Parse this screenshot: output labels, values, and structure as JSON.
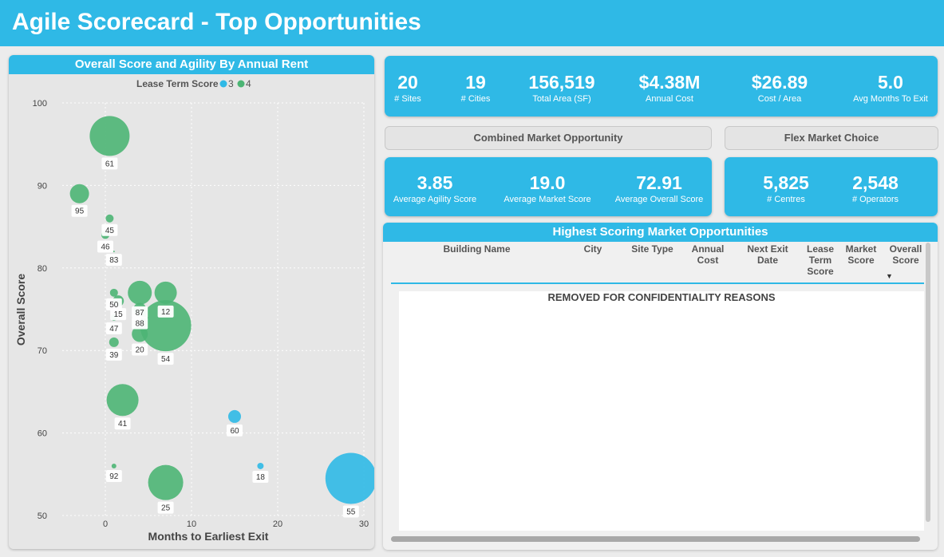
{
  "header": {
    "title": "Agile Scorecard - Top Opportunities"
  },
  "left_panel": {
    "title": "Overall Score and Agility By Annual Rent"
  },
  "kpis_top": [
    {
      "value": "20",
      "label": "# Sites"
    },
    {
      "value": "19",
      "label": "# Cities"
    },
    {
      "value": "156,519",
      "label": "Total Area (SF)"
    },
    {
      "value": "$4.38M",
      "label": "Annual Cost"
    },
    {
      "value": "$26.89",
      "label": "Cost / Area"
    },
    {
      "value": "5.0",
      "label": "Avg Months To Exit"
    }
  ],
  "sections": {
    "combined": "Combined Market Opportunity",
    "flex": "Flex Market Choice"
  },
  "kpis_combined": [
    {
      "value": "3.85",
      "label": "Average Agility Score"
    },
    {
      "value": "19.0",
      "label": "Average Market Score"
    },
    {
      "value": "72.91",
      "label": "Average Overall Score"
    }
  ],
  "kpis_flex": [
    {
      "value": "5,825",
      "label": "# Centres"
    },
    {
      "value": "2,548",
      "label": "# Operators"
    }
  ],
  "table": {
    "title": "Highest Scoring Market Opportunities",
    "columns": [
      "Building Name",
      "City",
      "Site Type",
      "Annual Cost",
      "Next Exit Date",
      "Lease Term Score",
      "Market Score",
      "Overall Score"
    ],
    "sort_indicator": "▼",
    "removed_text": "REMOVED FOR CONFIDENTIALITY REASONS"
  },
  "chart_data": {
    "type": "scatter",
    "title": "Overall Score and Agility By Annual Rent",
    "xlabel": "Months to Earliest Exit",
    "ylabel": "Overall Score",
    "xlim": [
      -5,
      30
    ],
    "ylim": [
      50,
      100
    ],
    "xticks": [
      0,
      10,
      20,
      30
    ],
    "yticks": [
      50,
      60,
      70,
      80,
      90,
      100
    ],
    "grid": true,
    "legend": {
      "title": "Lease Term Score",
      "placement": "top",
      "entries": [
        {
          "name": "3",
          "color": "#2fb9e6"
        },
        {
          "name": "4",
          "color": "#4cb574"
        }
      ]
    },
    "series": [
      {
        "name": "3",
        "color": "#2fb9e6",
        "points": [
          {
            "x": 15,
            "y": 62,
            "size": 8,
            "label": "60"
          },
          {
            "x": 18,
            "y": 56,
            "size": 4,
            "label": "18"
          },
          {
            "x": 28.5,
            "y": 54.5,
            "size": 32,
            "label": "55"
          }
        ]
      },
      {
        "name": "4",
        "color": "#4cb574",
        "points": [
          {
            "x": 0.5,
            "y": 96,
            "size": 25,
            "label": "61"
          },
          {
            "x": -3,
            "y": 89,
            "size": 12,
            "label": "95"
          },
          {
            "x": 0.5,
            "y": 86,
            "size": 5,
            "label": "45"
          },
          {
            "x": 0,
            "y": 84,
            "size": 5,
            "label": "46"
          },
          {
            "x": 1,
            "y": 82,
            "size": 1,
            "label": "83"
          },
          {
            "x": 1,
            "y": 77,
            "size": 5,
            "label": "50"
          },
          {
            "x": 4,
            "y": 77,
            "size": 15,
            "label": "87"
          },
          {
            "x": 7,
            "y": 77,
            "size": 14,
            "label": "12"
          },
          {
            "x": 1.5,
            "y": 76,
            "size": 7,
            "label": "15"
          },
          {
            "x": 4,
            "y": 75,
            "size": 8,
            "label": "88"
          },
          {
            "x": 7,
            "y": 73,
            "size": 32,
            "label": "54"
          },
          {
            "x": 1,
            "y": 74,
            "size": 4,
            "label": "47"
          },
          {
            "x": 4,
            "y": 72,
            "size": 10,
            "label": "20"
          },
          {
            "x": 1,
            "y": 71,
            "size": 6,
            "label": "39"
          },
          {
            "x": 2,
            "y": 64,
            "size": 20,
            "label": "41"
          },
          {
            "x": 1,
            "y": 56,
            "size": 3,
            "label": "92"
          },
          {
            "x": 7,
            "y": 54,
            "size": 22,
            "label": "25"
          }
        ]
      }
    ]
  }
}
